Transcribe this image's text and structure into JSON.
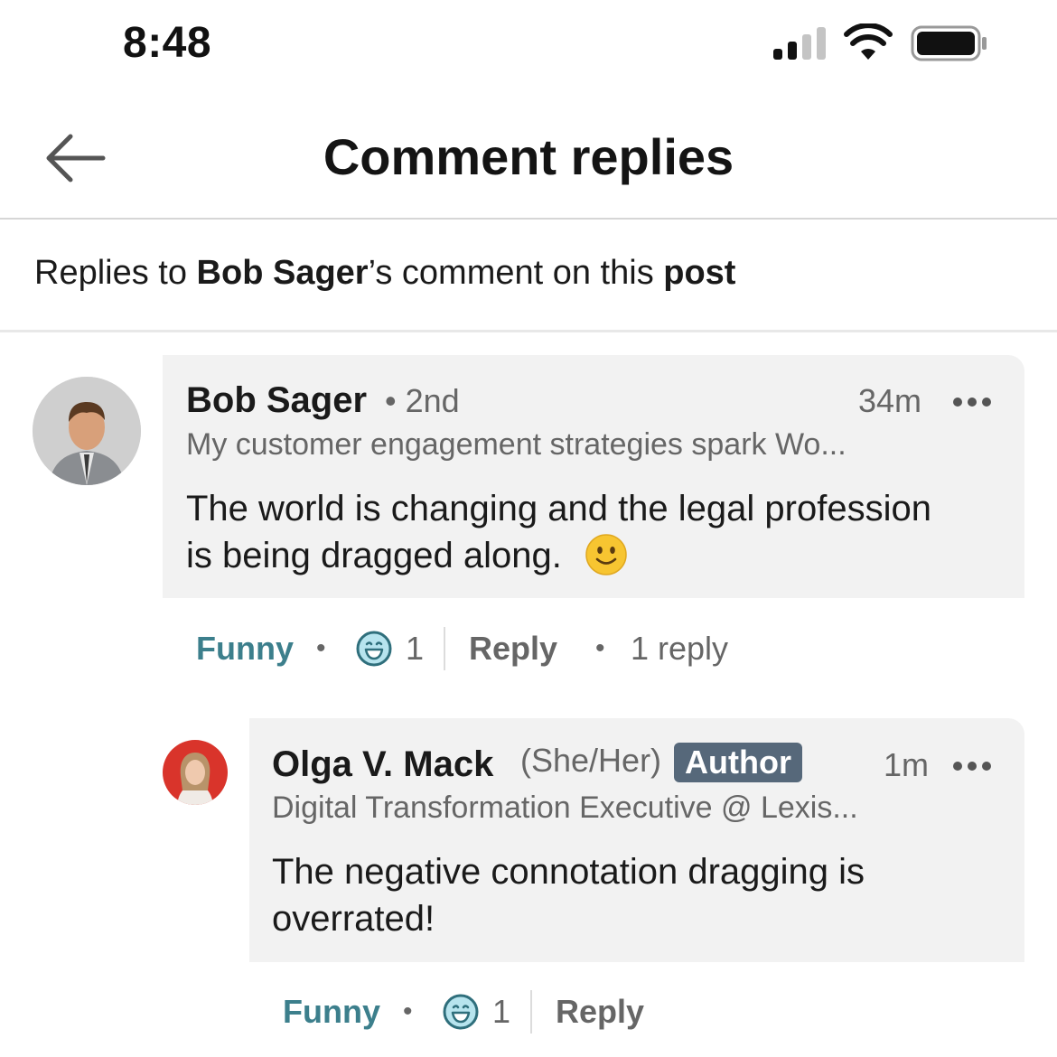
{
  "status_bar": {
    "time": "8:48"
  },
  "header": {
    "title": "Comment replies"
  },
  "context": {
    "prefix": "Replies to ",
    "commenter": "Bob Sager",
    "middle": "’s comment on this ",
    "post": "post"
  },
  "comments": [
    {
      "name": "Bob Sager",
      "degree": "• 2nd",
      "headline": "My customer engagement strategies spark Wo...",
      "time": "34m",
      "text_line1": "The world is changing and the legal profession",
      "text_line2": "is being dragged along.",
      "reaction_label": "Funny",
      "reaction_count": "1",
      "reply_label": "Reply",
      "replies_count": "1 reply"
    },
    {
      "name": "Olga V. Mack",
      "pronouns": "(She/Her)",
      "badge": "Author",
      "headline": "Digital Transformation Executive @ Lexis...",
      "time": "1m",
      "text_line1": "The negative connotation dragging is",
      "text_line2": "overrated!",
      "reaction_label": "Funny",
      "reaction_count": "1",
      "reply_label": "Reply"
    }
  ],
  "icons": {
    "back": "arrow-left-icon",
    "more": "ellipsis-icon",
    "reaction": "laughing-face-icon",
    "emoji": "smiling-face-emoji"
  },
  "colors": {
    "funny": "#3c7f8c",
    "badge": "#56687a",
    "bubble": "#f2f2f2"
  }
}
